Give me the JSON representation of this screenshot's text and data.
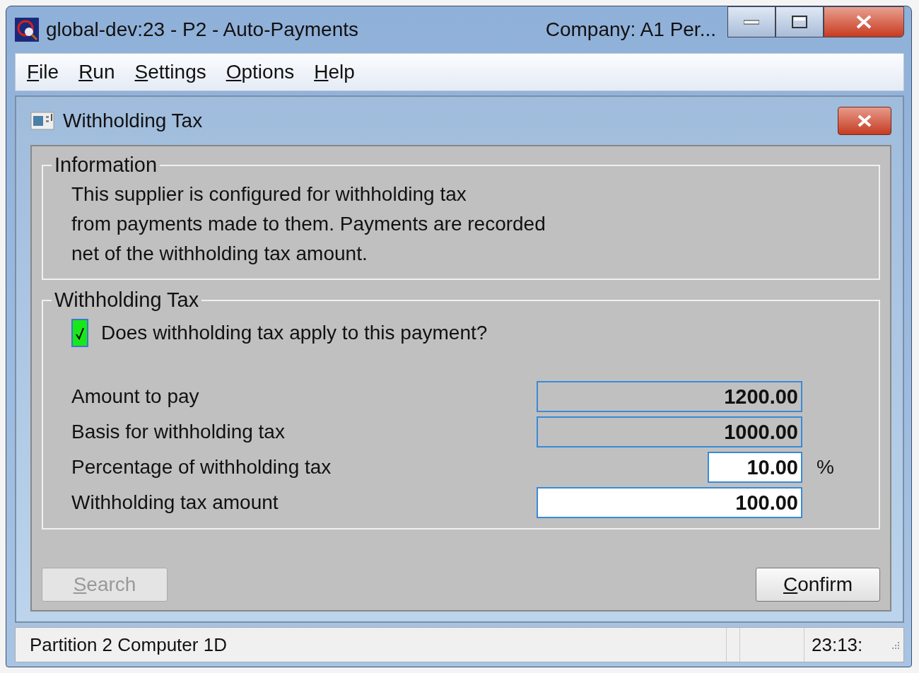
{
  "window": {
    "title": "global-dev:23 - P2 - Auto-Payments",
    "company": "Company: A1  Per..."
  },
  "menu": [
    "File",
    "Run",
    "Settings",
    "Options",
    "Help"
  ],
  "dialog": {
    "title": "Withholding Tax",
    "information": {
      "legend": "Information",
      "lines": [
        "This supplier is configured for withholding tax",
        "from payments made to them. Payments are recorded",
        "net of the withholding tax amount."
      ]
    },
    "withholding": {
      "legend": "Withholding Tax",
      "checkbox": {
        "label": "Does withholding tax apply to this payment?",
        "checked": true
      },
      "fields": [
        {
          "label": "Amount to pay",
          "value": "1200.00",
          "readonly": true
        },
        {
          "label": "Basis for withholding tax",
          "value": "1000.00",
          "readonly": true
        },
        {
          "label": "Percentage of withholding tax",
          "value": "10.00",
          "readonly": false,
          "unit": "%"
        },
        {
          "label": "Withholding tax amount",
          "value": "100.00",
          "readonly": false
        }
      ]
    },
    "buttons": [
      {
        "label": "Search",
        "disabled": true
      },
      {
        "label": "Confirm",
        "disabled": false
      }
    ]
  },
  "status_bar": {
    "text": "Partition 2 Computer 1D",
    "time": "23:13:"
  }
}
